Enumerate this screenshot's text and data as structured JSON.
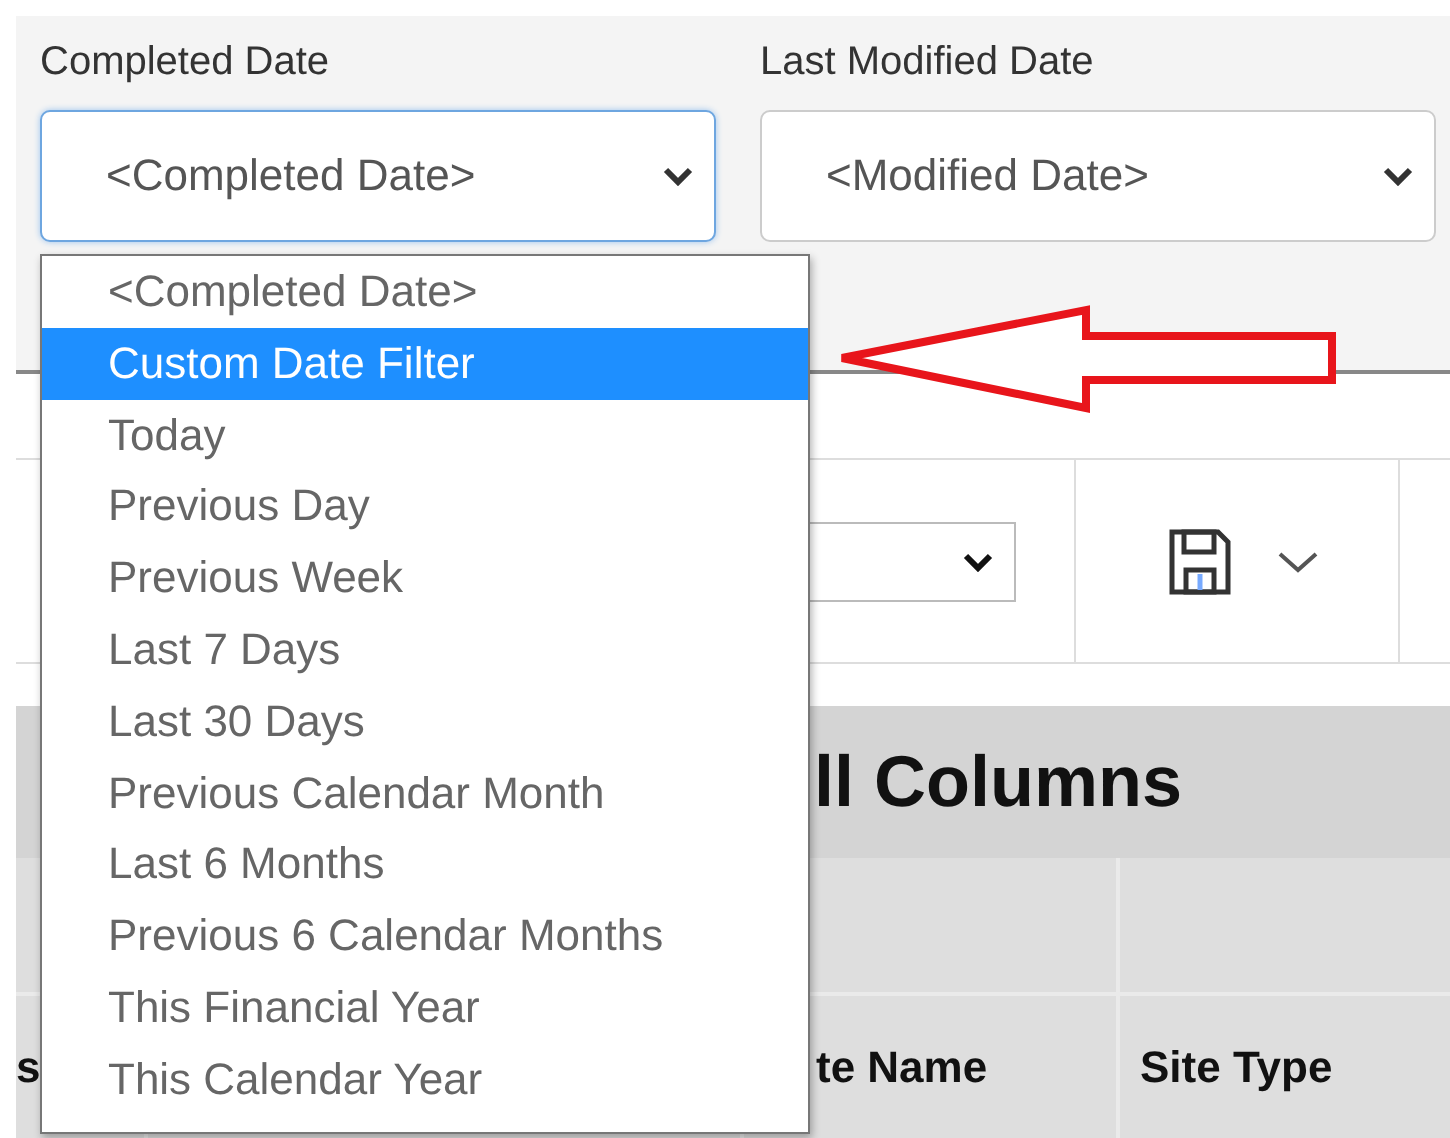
{
  "filters": [
    {
      "label": "Completed Date",
      "value": "<Completed Date>",
      "focused": true
    },
    {
      "label": "Last Modified Date",
      "value": "<Modified Date>",
      "focused": false
    }
  ],
  "dropdown": {
    "options": [
      {
        "label": "<Completed Date>",
        "selected": false
      },
      {
        "label": "Custom Date Filter",
        "selected": true
      },
      {
        "label": "Today",
        "selected": false
      },
      {
        "label": "Previous Day",
        "selected": false
      },
      {
        "label": "Previous Week",
        "selected": false
      },
      {
        "label": "Last 7 Days",
        "selected": false
      },
      {
        "label": "Last 30 Days",
        "selected": false
      },
      {
        "label": "Previous Calendar Month",
        "selected": false
      },
      {
        "label": "Last 6 Months",
        "selected": false
      },
      {
        "label": "Previous 6 Calendar Months",
        "selected": false
      },
      {
        "label": "This Financial Year",
        "selected": false
      },
      {
        "label": "This Calendar Year",
        "selected": false
      }
    ]
  },
  "heading": {
    "visible_fragment": "ll Columns"
  },
  "table": {
    "header_cells": [
      "s",
      "te Name",
      "Site Type"
    ]
  }
}
